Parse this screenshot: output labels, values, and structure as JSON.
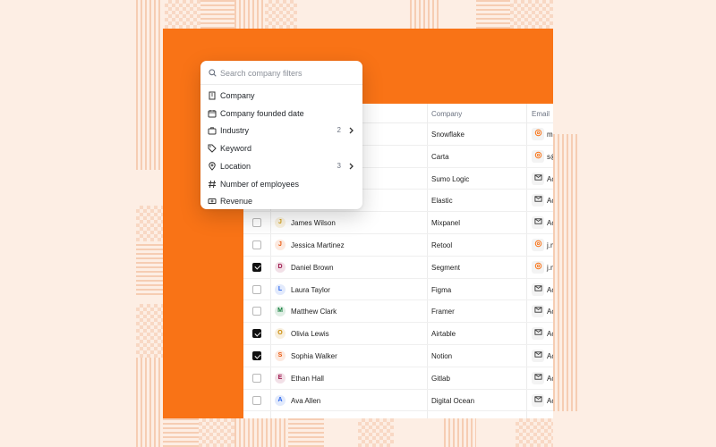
{
  "filter_menu": {
    "search_placeholder": "Search company filters",
    "items": [
      {
        "label": "Company",
        "icon": "building-icon",
        "count": "",
        "has_submenu": false
      },
      {
        "label": "Company founded date",
        "icon": "calendar-icon",
        "count": "",
        "has_submenu": false
      },
      {
        "label": "Industry",
        "icon": "briefcase-icon",
        "count": "2",
        "has_submenu": true
      },
      {
        "label": "Keyword",
        "icon": "tag-icon",
        "count": "",
        "has_submenu": false
      },
      {
        "label": "Location",
        "icon": "map-pin-icon",
        "count": "3",
        "has_submenu": true
      },
      {
        "label": "Number of employees",
        "icon": "hash-icon",
        "count": "",
        "has_submenu": false
      },
      {
        "label": "Revenue",
        "icon": "banknote-icon",
        "count": "",
        "has_submenu": false
      }
    ]
  },
  "table": {
    "headers": {
      "company": "Company",
      "email": "Email"
    },
    "rows": [
      {
        "name": "",
        "initial": "",
        "checked": false,
        "company": "Snowflake",
        "email_icon": "at-icon",
        "email": "mi",
        "avatar_color": ""
      },
      {
        "name": "",
        "initial": "",
        "checked": false,
        "company": "Carta",
        "email_icon": "at-icon",
        "email": "s@",
        "avatar_color": ""
      },
      {
        "name": "",
        "initial": "",
        "checked": false,
        "company": "Sumo Logic",
        "email_icon": "mail-icon",
        "email": "Ac",
        "avatar_color": ""
      },
      {
        "name": "",
        "initial": "",
        "checked": false,
        "company": "Elastic",
        "email_icon": "mail-icon",
        "email": "Ac",
        "avatar_color": ""
      },
      {
        "name": "James Wilson",
        "initial": "J",
        "checked": false,
        "company": "Mixpanel",
        "email_icon": "mail-icon",
        "email": "Ac",
        "avatar_color": "#d4a017"
      },
      {
        "name": "Jessica Martinez",
        "initial": "J",
        "checked": false,
        "company": "Retool",
        "email_icon": "at-icon",
        "email": "j.m",
        "avatar_color": "#ea580c"
      },
      {
        "name": "Daniel Brown",
        "initial": "D",
        "checked": true,
        "company": "Segment",
        "email_icon": "at-icon",
        "email": "j.m",
        "avatar_color": "#9d174d"
      },
      {
        "name": "Laura Taylor",
        "initial": "L",
        "checked": false,
        "company": "Figma",
        "email_icon": "mail-icon",
        "email": "Ac",
        "avatar_color": "#2563eb"
      },
      {
        "name": "Matthew Clark",
        "initial": "M",
        "checked": false,
        "company": "Framer",
        "email_icon": "mail-icon",
        "email": "Ac",
        "avatar_color": "#15803d"
      },
      {
        "name": "Olivia Lewis",
        "initial": "O",
        "checked": true,
        "company": "Airtable",
        "email_icon": "mail-icon",
        "email": "Ac",
        "avatar_color": "#ca8a04"
      },
      {
        "name": "Sophia Walker",
        "initial": "S",
        "checked": true,
        "company": "Notion",
        "email_icon": "mail-icon",
        "email": "Ac",
        "avatar_color": "#ea580c"
      },
      {
        "name": "Ethan Hall",
        "initial": "E",
        "checked": false,
        "company": "Gitlab",
        "email_icon": "mail-icon",
        "email": "Ac",
        "avatar_color": "#9d174d"
      },
      {
        "name": "Ava Allen",
        "initial": "A",
        "checked": false,
        "company": "Digital Ocean",
        "email_icon": "mail-icon",
        "email": "Ac",
        "avatar_color": "#2563eb"
      }
    ]
  },
  "colors": {
    "background": "#fdeee4",
    "accent_orange": "#f97316",
    "card": "#ffffff",
    "checkbox_checked": "#111111"
  }
}
